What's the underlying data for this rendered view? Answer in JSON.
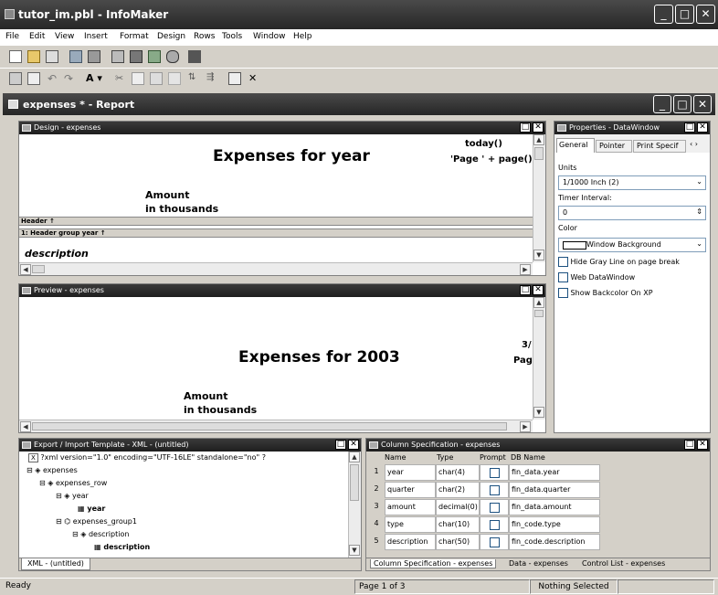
{
  "app": {
    "title": "tutor_im.pbl - InfoMaker"
  },
  "menu": [
    "File",
    "Edit",
    "View",
    "Insert",
    "Format",
    "Design",
    "Rows",
    "Tools",
    "Window",
    "Help"
  ],
  "report_window": {
    "title": "expenses * - Report"
  },
  "design_pane": {
    "title": "Design - expenses",
    "heading": "Expenses for  year",
    "today": "today()",
    "page_expr": "'Page ' + page()",
    "amount_label": "Amount",
    "amount_label2": "in thousands",
    "band_header": "Header ↑",
    "band_group": "1: Header group year ↑",
    "description": "description"
  },
  "preview_pane": {
    "title": "Preview - expenses",
    "heading": "Expenses for  2003",
    "date_fragment": "3/",
    "page_fragment": "Pag",
    "amount_label": "Amount",
    "amount_label2": "in thousands"
  },
  "properties": {
    "title": "Properties - DataWindow",
    "tabs": [
      "General",
      "Pointer",
      "Print Specif"
    ],
    "units_label": "Units",
    "units_value": "1/1000 Inch (2)",
    "timer_label": "Timer Interval:",
    "timer_value": "0",
    "color_label": "Color",
    "color_value": "Window Background",
    "checks": [
      "Hide Gray Line on page break",
      "Web DataWindow",
      "Show Backcolor On XP"
    ]
  },
  "export_pane": {
    "title": "Export / Import Template - XML - (untitled)",
    "tree": [
      "?xml version=\"1.0\" encoding=\"UTF-16LE\" standalone=\"no\" ?",
      "expenses",
      "expenses_row",
      "year",
      "year",
      "expenses_group1",
      "description",
      "description"
    ],
    "tab": "XML - (untitled)"
  },
  "column_spec": {
    "title": "Column Specification - expenses",
    "headers": [
      "Name",
      "Type",
      "Prompt",
      "DB Name"
    ],
    "rows": [
      {
        "n": "1",
        "name": "year",
        "type": "char(4)",
        "db": "fin_data.year"
      },
      {
        "n": "2",
        "name": "quarter",
        "type": "char(2)",
        "db": "fin_data.quarter"
      },
      {
        "n": "3",
        "name": "amount",
        "type": "decimal(0)",
        "db": "fin_data.amount"
      },
      {
        "n": "4",
        "name": "type",
        "type": "char(10)",
        "db": "fin_code.type"
      },
      {
        "n": "5",
        "name": "description",
        "type": "char(50)",
        "db": "fin_code.description"
      }
    ],
    "tabs": [
      "Column Specification - expenses",
      "Data - expenses",
      "Control List - expenses"
    ]
  },
  "status": {
    "ready": "Ready",
    "page": "Page 1 of 3",
    "selection": "Nothing Selected"
  },
  "colors": {
    "titlebar": "#2a2a2a",
    "face": "#d4d0c8",
    "accent": "#1c5180"
  }
}
